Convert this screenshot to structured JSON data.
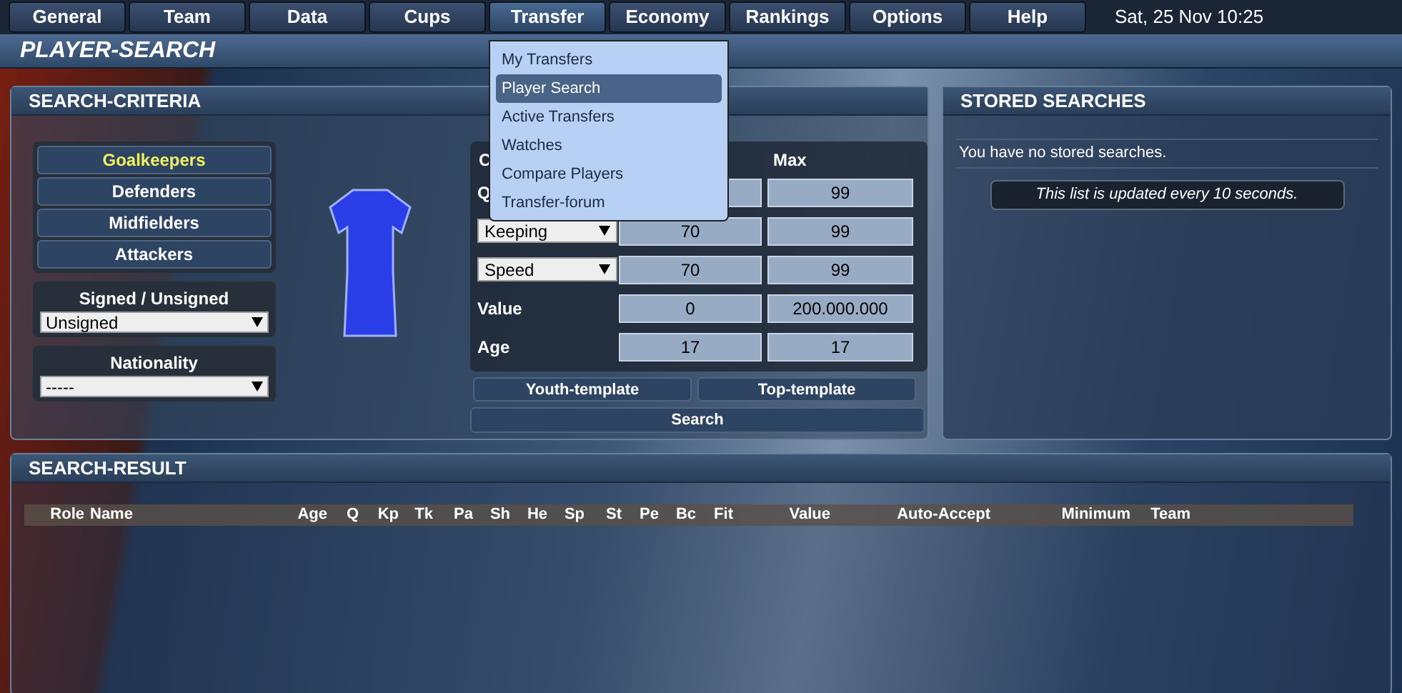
{
  "nav": [
    {
      "label": "General",
      "selected": false
    },
    {
      "label": "Team",
      "selected": false
    },
    {
      "label": "Data",
      "selected": false
    },
    {
      "label": "Cups",
      "selected": false
    },
    {
      "label": "Transfer",
      "selected": true
    },
    {
      "label": "Economy",
      "selected": false
    },
    {
      "label": "Rankings",
      "selected": false
    },
    {
      "label": "Options",
      "selected": false
    },
    {
      "label": "Help",
      "selected": false
    }
  ],
  "datetime": "Sat, 25 Nov 10:25",
  "transfer_menu": [
    {
      "label": "My Transfers",
      "selected": false
    },
    {
      "label": "Player Search",
      "selected": true
    },
    {
      "label": "Active Transfers",
      "selected": false
    },
    {
      "label": "Watches",
      "selected": false
    },
    {
      "label": "Compare Players",
      "selected": false
    },
    {
      "label": "Transfer-forum",
      "selected": false
    }
  ],
  "page_title": "PLAYER-SEARCH",
  "criteria_panel": {
    "title": "SEARCH-CRITERIA",
    "positions": [
      {
        "label": "Goalkeepers",
        "selected": true
      },
      {
        "label": "Defenders",
        "selected": false
      },
      {
        "label": "Midfielders",
        "selected": false
      },
      {
        "label": "Attackers",
        "selected": false
      }
    ],
    "signed": {
      "label": "Signed / Unsigned",
      "value": "Unsigned"
    },
    "nationality": {
      "label": "Nationality",
      "value": "-----"
    },
    "table_header": {
      "criteria": "C",
      "max": "Max"
    },
    "rows": [
      {
        "kind": "label",
        "label": "Q",
        "max": "99"
      },
      {
        "kind": "select",
        "label": "Keeping",
        "min": "70",
        "max": "99"
      },
      {
        "kind": "select",
        "label": "Speed",
        "min": "70",
        "max": "99"
      },
      {
        "kind": "label",
        "label": "Value",
        "min": "0",
        "max": "200.000.000"
      },
      {
        "kind": "label",
        "label": "Age",
        "min": "17",
        "max": "17"
      }
    ],
    "templates": [
      "Youth-template",
      "Top-template"
    ],
    "search_button": "Search"
  },
  "stored_panel": {
    "title": "STORED SEARCHES",
    "empty_text": "You have no stored searches.",
    "note": "This list is updated every 10 seconds."
  },
  "result_panel": {
    "title": "SEARCH-RESULT",
    "columns": [
      "Role",
      "Name",
      "Age",
      "Q",
      "Kp",
      "Tk",
      "Pa",
      "Sh",
      "He",
      "Sp",
      "St",
      "Pe",
      "Bc",
      "Fit",
      "Value",
      "Auto-Accept",
      "Minimum",
      "Team"
    ]
  }
}
